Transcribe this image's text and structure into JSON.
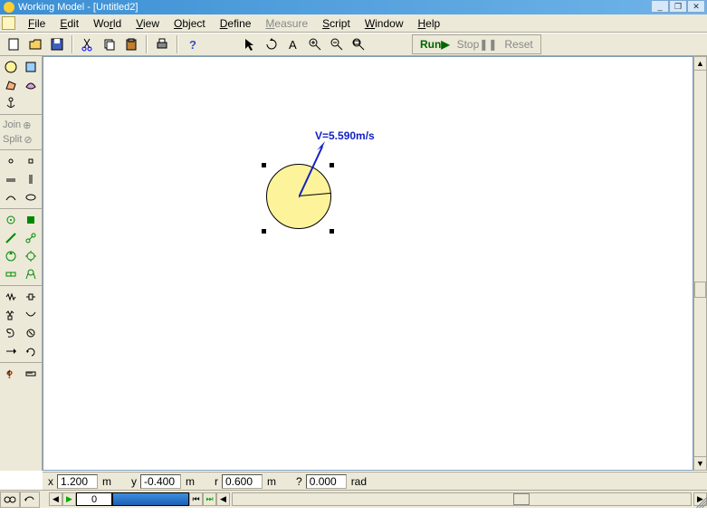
{
  "title": "Working Model - [Untitled2]",
  "menus": [
    "File",
    "Edit",
    "World",
    "View",
    "Object",
    "Define",
    "Measure",
    "Script",
    "Window",
    "Help"
  ],
  "menus_disabled_index": 6,
  "run": {
    "run": "Run",
    "stop": "Stop",
    "reset": "Reset"
  },
  "join_label": "Join",
  "split_label": "Split",
  "velocity_label": "V=5.590m/s",
  "status": {
    "x_label": "x",
    "x_val": "1.200",
    "x_unit": "m",
    "y_label": "y",
    "y_val": "-0.400",
    "y_unit": "m",
    "r_label": "r",
    "r_val": "0.600",
    "r_unit": "m",
    "a_label": "?",
    "a_val": "0.000",
    "a_unit": "rad"
  },
  "frame": "0"
}
